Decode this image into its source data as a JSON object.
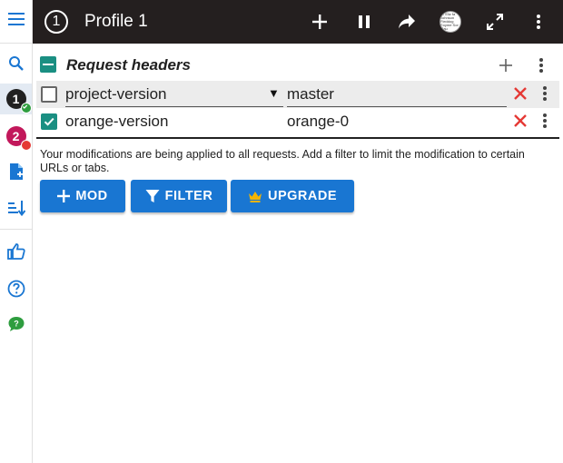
{
  "sidebar": {
    "items": [
      {
        "name": "menu-icon"
      },
      {
        "name": "search-icon"
      },
      {
        "profile_number": "1",
        "color": "#212121",
        "status_color": "#2e9d3f"
      },
      {
        "profile_number": "2",
        "color": "#c2185b",
        "status_color": "#e53935"
      },
      {
        "name": "add-file-icon"
      },
      {
        "name": "sort-icon"
      },
      {
        "name": "thumbs-up-icon"
      },
      {
        "name": "help-icon"
      },
      {
        "name": "feedback-icon"
      }
    ]
  },
  "header": {
    "profile_number": "1",
    "title": "Profile 1",
    "avatar_text": "Dr Eliz fa Johnson Fieddog Eoyme Sor Mau"
  },
  "section": {
    "title": "Request headers"
  },
  "headers": [
    {
      "enabled": false,
      "name": "project-version",
      "value": "master"
    },
    {
      "enabled": true,
      "name": "orange-version",
      "value": "orange-0"
    }
  ],
  "note": "Your modifications are being applied to all requests. Add a filter to limit the modification to certain URLs or tabs.",
  "buttons": {
    "mod": "MOD",
    "filter": "FILTER",
    "upgrade": "UPGRADE"
  },
  "colors": {
    "topbar": "#241f1f",
    "accent": "#1976d2",
    "teal": "#1a8f82",
    "delete": "#e53935",
    "crown": "#f4b400"
  }
}
